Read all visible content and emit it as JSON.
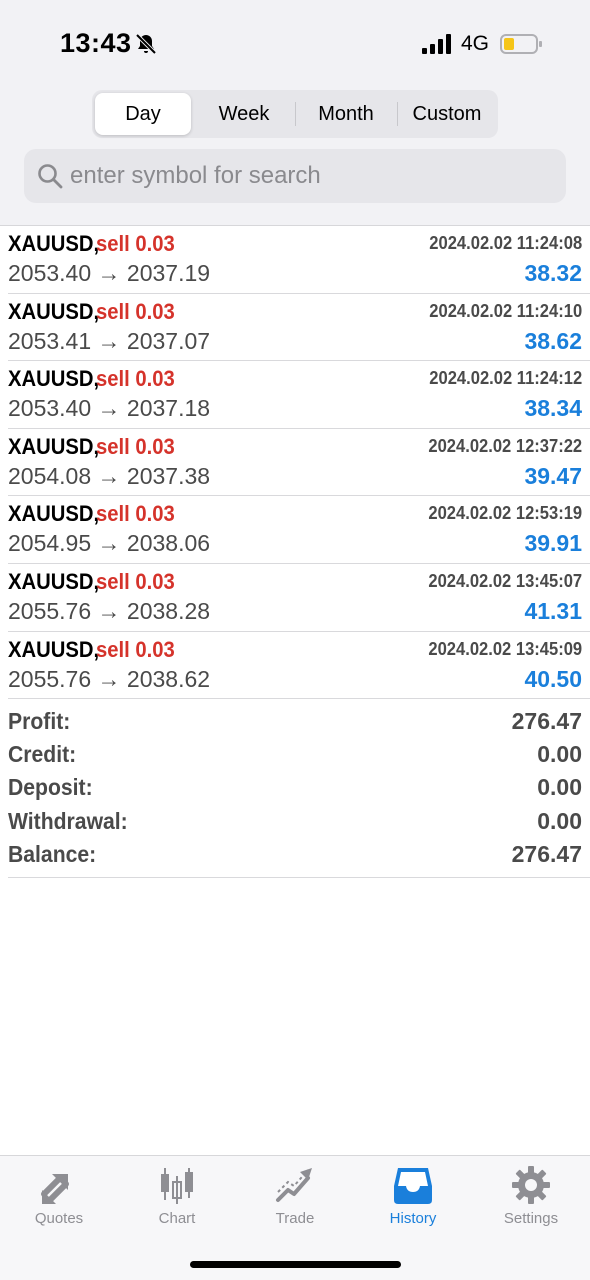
{
  "status_bar": {
    "time": "13:43",
    "network": "4G"
  },
  "period_tabs": [
    {
      "label": "Day",
      "active": true
    },
    {
      "label": "Week",
      "active": false
    },
    {
      "label": "Month",
      "active": false
    },
    {
      "label": "Custom",
      "active": false
    }
  ],
  "search": {
    "placeholder": "enter symbol for search",
    "value": ""
  },
  "deals": [
    {
      "symbol": "XAUUSD,",
      "type": "sell 0.03",
      "time": "2024.02.02 11:24:08",
      "prices": "2053.40 → 2037.19",
      "profit": "38.32"
    },
    {
      "symbol": "XAUUSD,",
      "type": "sell 0.03",
      "time": "2024.02.02 11:24:10",
      "prices": "2053.41 → 2037.07",
      "profit": "38.62"
    },
    {
      "symbol": "XAUUSD,",
      "type": "sell 0.03",
      "time": "2024.02.02 11:24:12",
      "prices": "2053.40 → 2037.18",
      "profit": "38.34"
    },
    {
      "symbol": "XAUUSD,",
      "type": "sell 0.03",
      "time": "2024.02.02 12:37:22",
      "prices": "2054.08 → 2037.38",
      "profit": "39.47"
    },
    {
      "symbol": "XAUUSD,",
      "type": "sell 0.03",
      "time": "2024.02.02 12:53:19",
      "prices": "2054.95 → 2038.06",
      "profit": "39.91"
    },
    {
      "symbol": "XAUUSD,",
      "type": "sell 0.03",
      "time": "2024.02.02 13:45:07",
      "prices": "2055.76 → 2038.28",
      "profit": "41.31"
    },
    {
      "symbol": "XAUUSD,",
      "type": "sell 0.03",
      "time": "2024.02.02 13:45:09",
      "prices": "2055.76 → 2038.62",
      "profit": "40.50"
    }
  ],
  "summary": [
    {
      "label": "Profit:",
      "value": "276.47"
    },
    {
      "label": "Credit:",
      "value": "0.00"
    },
    {
      "label": "Deposit:",
      "value": "0.00"
    },
    {
      "label": "Withdrawal:",
      "value": "0.00"
    },
    {
      "label": "Balance:",
      "value": "276.47"
    }
  ],
  "tabbar": [
    {
      "label": "Quotes",
      "icon": "quotes-icon",
      "active": false
    },
    {
      "label": "Chart",
      "icon": "chart-icon",
      "active": false
    },
    {
      "label": "Trade",
      "icon": "trade-icon",
      "active": false
    },
    {
      "label": "History",
      "icon": "history-icon",
      "active": true
    },
    {
      "label": "Settings",
      "icon": "settings-icon",
      "active": false
    }
  ],
  "colors": {
    "sell": "#d5332b",
    "profit": "#1a7fdb",
    "active_tab": "#1a7fdb",
    "inactive_tab": "#8e8e93",
    "battery_level": "#f5c518"
  }
}
